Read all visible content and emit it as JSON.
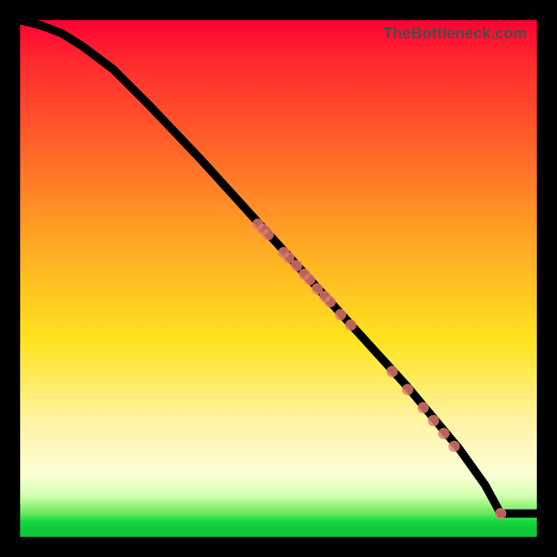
{
  "watermark": "TheBottleneck.com",
  "colors": {
    "dot": "#e17a72",
    "line": "#000000",
    "frame": "#000000"
  },
  "chart_data": {
    "type": "line",
    "title": "",
    "xlabel": "",
    "ylabel": "",
    "xlim": [
      0,
      100
    ],
    "ylim": [
      0,
      100
    ],
    "series": [
      {
        "name": "curve",
        "x": [
          0,
          4,
          8,
          12,
          18,
          25,
          35,
          45,
          55,
          65,
          75,
          85,
          90,
          93,
          100
        ],
        "y": [
          100,
          99,
          97.5,
          95,
          90.5,
          83.5,
          73,
          62,
          51,
          40,
          29,
          17,
          10,
          4.5,
          4.5
        ]
      }
    ],
    "points": [
      {
        "x": 46,
        "y": 60.5
      },
      {
        "x": 47,
        "y": 59.5
      },
      {
        "x": 48,
        "y": 58.5
      },
      {
        "x": 51,
        "y": 55
      },
      {
        "x": 52,
        "y": 54
      },
      {
        "x": 53.5,
        "y": 52.5
      },
      {
        "x": 55,
        "y": 50.8
      },
      {
        "x": 56,
        "y": 49.8
      },
      {
        "x": 57.5,
        "y": 48
      },
      {
        "x": 59,
        "y": 46.5
      },
      {
        "x": 60,
        "y": 45.5
      },
      {
        "x": 62,
        "y": 43
      },
      {
        "x": 64,
        "y": 41
      },
      {
        "x": 72,
        "y": 32
      },
      {
        "x": 75,
        "y": 28.5
      },
      {
        "x": 78,
        "y": 25
      },
      {
        "x": 80,
        "y": 22.5
      },
      {
        "x": 82,
        "y": 20
      },
      {
        "x": 84,
        "y": 17.5
      },
      {
        "x": 93,
        "y": 4.5
      }
    ],
    "point_radius": 1.1
  }
}
